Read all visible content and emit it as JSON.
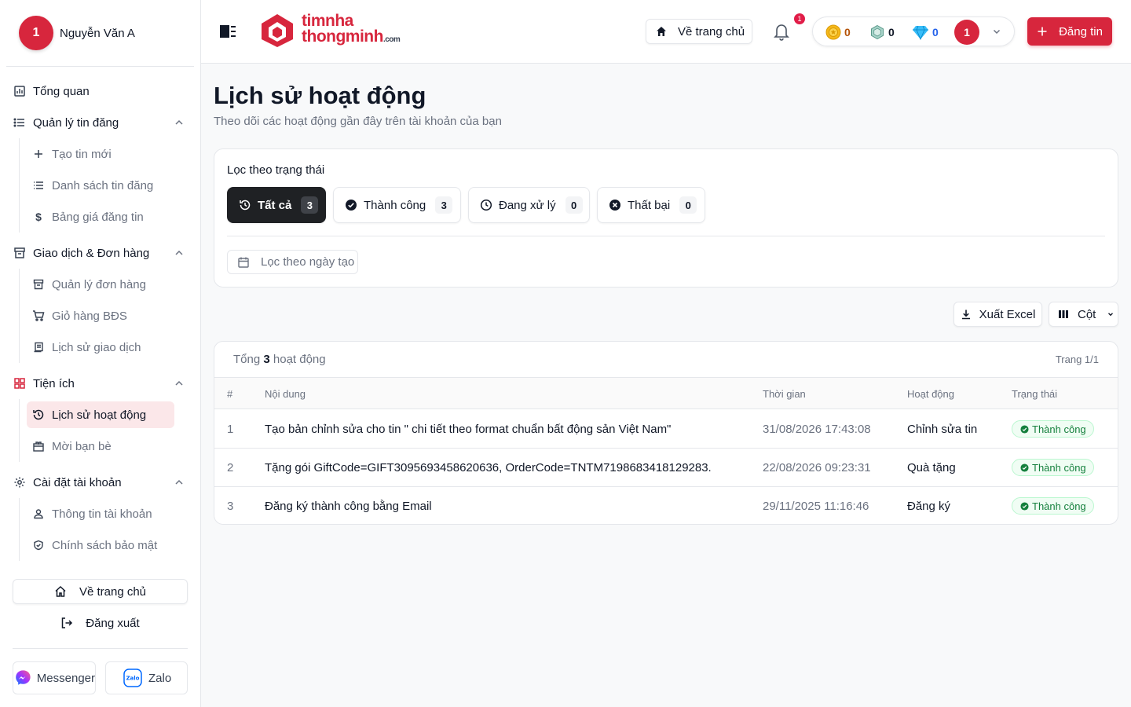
{
  "sidebar": {
    "user": {
      "avatar": "1",
      "name": "Nguyễn Văn A"
    },
    "overview": "Tổng quan",
    "groups": {
      "posts": {
        "label": "Quản lý tin đăng",
        "items": [
          "Tạo tin mới",
          "Danh sách tin đăng",
          "Bảng giá đăng tin"
        ]
      },
      "orders": {
        "label": "Giao dịch & Đơn hàng",
        "items": [
          "Quản lý đơn hàng",
          "Giỏ hàng BĐS",
          "Lịch sử giao dịch"
        ]
      },
      "utilities": {
        "label": "Tiện ích",
        "items": [
          "Lịch sử hoạt động",
          "Mời bạn bè"
        ]
      },
      "account": {
        "label": "Cài đặt tài khoản",
        "items": [
          "Thông tin tài khoản",
          "Chính sách bảo mật"
        ]
      }
    },
    "home_button": "Về trang chủ",
    "logout_button": "Đăng xuất",
    "messenger": "Messenger",
    "zalo": "Zalo"
  },
  "header": {
    "logo_line1": "timnha",
    "logo_line2": "thongminh",
    "logo_suffix": ".com",
    "home_button": "Về trang chủ",
    "notification_count": "1",
    "wallet": {
      "coins": "0",
      "points": "0",
      "diamonds": "0",
      "avatar": "1"
    },
    "post_button": "Đăng tin"
  },
  "page": {
    "title": "Lịch sử hoạt động",
    "subtitle": "Theo dõi các hoạt động gần đây trên tài khoản của bạn"
  },
  "filters": {
    "label": "Lọc theo trạng thái",
    "chips": [
      {
        "label": "Tất cả",
        "count": "3"
      },
      {
        "label": "Thành công",
        "count": "3"
      },
      {
        "label": "Đang xử lý",
        "count": "0"
      },
      {
        "label": "Thất bại",
        "count": "0"
      }
    ],
    "date_placeholder": "Lọc theo ngày tạo"
  },
  "toolbar": {
    "export": "Xuất Excel",
    "columns": "Cột"
  },
  "table": {
    "total_prefix": "Tổng",
    "total_count": "3",
    "total_suffix": "hoạt động",
    "page_info": "Trang 1/1",
    "headers": [
      "#",
      "Nội dung",
      "Thời gian",
      "Hoạt động",
      "Trạng thái"
    ],
    "rows": [
      {
        "index": "1",
        "content": "Tạo bản chỉnh sửa cho tin \" chi tiết theo format chuẩn bất động sản Việt Nam\"",
        "time": "31/08/2026 17:43:08",
        "action": "Chỉnh sửa tin",
        "status": "Thành công"
      },
      {
        "index": "2",
        "content": "Tặng gói GiftCode=GIFT3095693458620636, OrderCode=TNTM7198683418129283.",
        "time": "22/08/2026 09:23:31",
        "action": "Quà tặng",
        "status": "Thành công"
      },
      {
        "index": "3",
        "content": "Đăng ký thành công bằng Email",
        "time": "29/11/2025 11:16:46",
        "action": "Đăng ký",
        "status": "Thành công"
      }
    ]
  },
  "colors": {
    "brand": "#d7263d",
    "success": "#15803d",
    "active_chip": "#1f2124"
  }
}
